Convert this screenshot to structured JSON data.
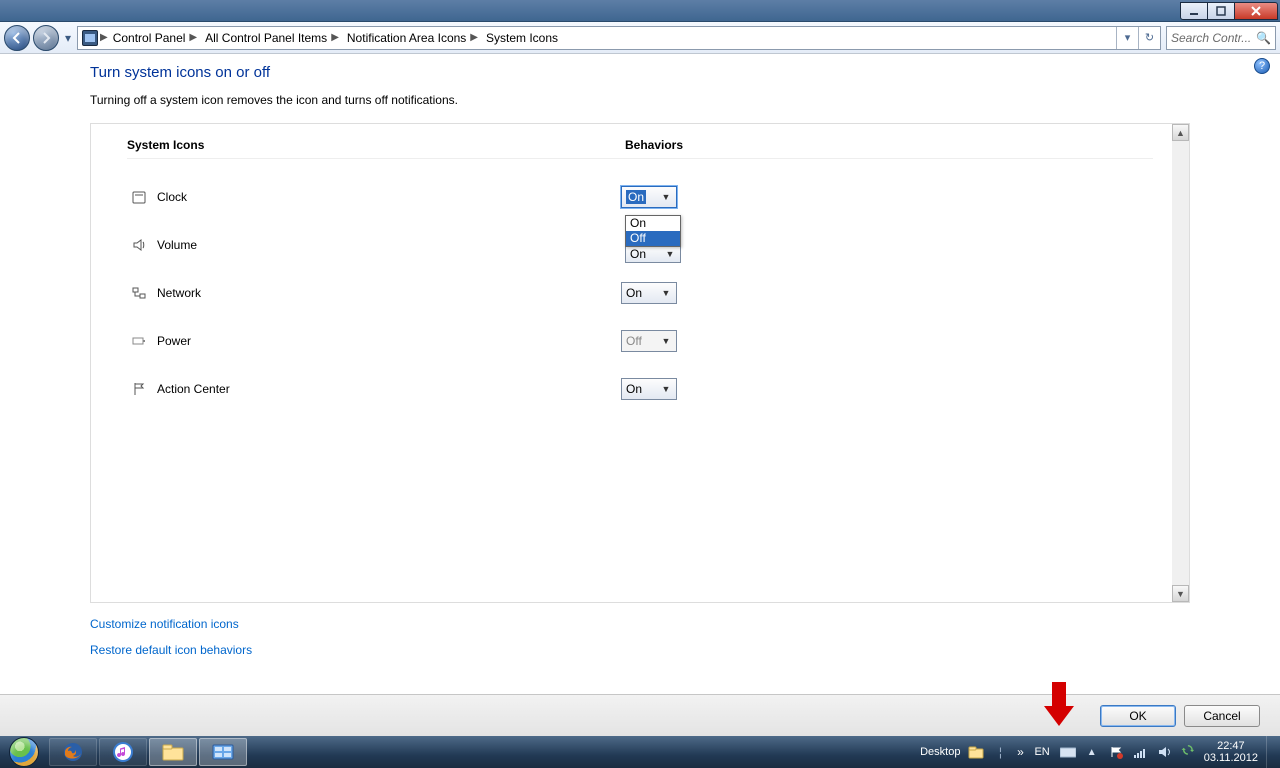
{
  "breadcrumb": {
    "items": [
      "Control Panel",
      "All Control Panel Items",
      "Notification Area Icons",
      "System Icons"
    ]
  },
  "search": {
    "placeholder": "Search Contr..."
  },
  "page": {
    "heading": "Turn system icons on or off",
    "subtext": "Turning off a system icon removes the icon and turns off notifications.",
    "col_icons": "System Icons",
    "col_behaviors": "Behaviors",
    "link_customize": "Customize notification icons",
    "link_restore": "Restore default icon behaviors"
  },
  "combo_options": {
    "on": "On",
    "off": "Off"
  },
  "rows": {
    "clock": {
      "label": "Clock",
      "value": "On",
      "disabled": false,
      "focused": true
    },
    "volume": {
      "label": "Volume",
      "value": "On",
      "partly_hidden_value": "On"
    },
    "network": {
      "label": "Network",
      "value": "On"
    },
    "power": {
      "label": "Power",
      "value": "Off",
      "disabled": true
    },
    "action": {
      "label": "Action Center",
      "value": "On"
    }
  },
  "buttons": {
    "ok": "OK",
    "cancel": "Cancel"
  },
  "taskbar": {
    "desktop_label": "Desktop",
    "lang": "EN",
    "time": "22:47",
    "date": "03.11.2012"
  }
}
